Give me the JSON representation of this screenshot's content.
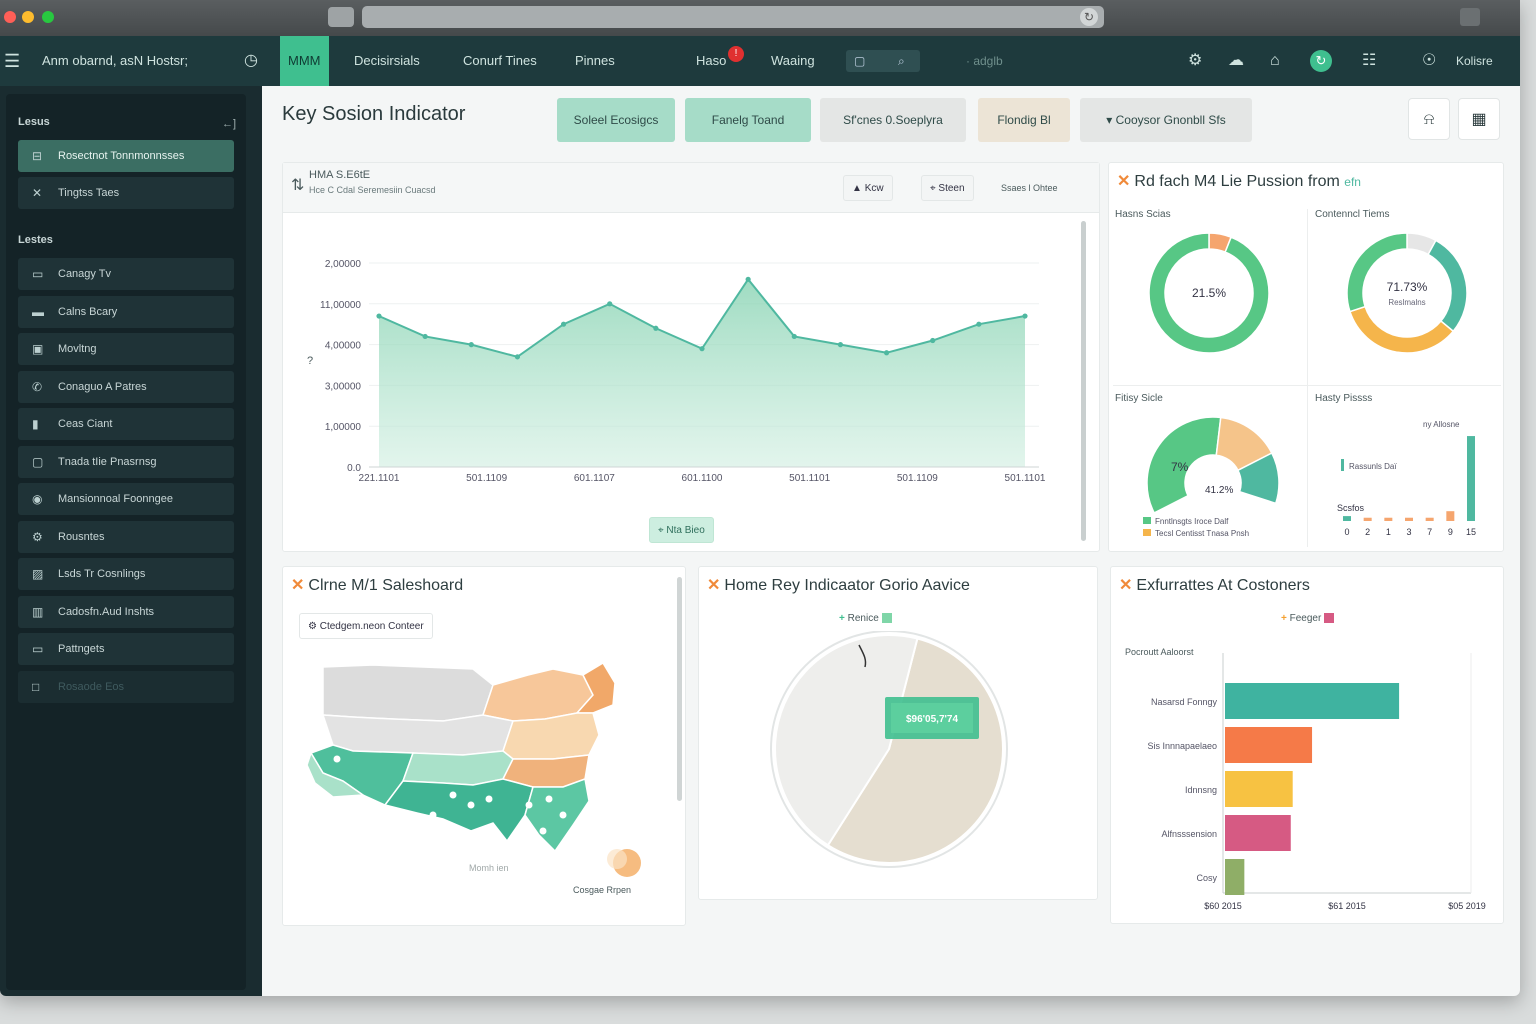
{
  "app": {
    "title": "Anm obarnd, asN Hostsr;",
    "window_icon": "camera-icon"
  },
  "nav": {
    "tabs": [
      {
        "label": "MMM",
        "active": true
      },
      {
        "label": "Decisirsials",
        "active": false
      },
      {
        "label": "Conurf Tines",
        "active": false
      },
      {
        "label": "Pinnes",
        "active": false
      },
      {
        "label": "Haso",
        "active": false
      },
      {
        "label": "Waaing",
        "active": false
      }
    ],
    "alert_count": "!",
    "search_icon_a": "▢",
    "search_icon_b": "⌕",
    "search_hint": "· adglb",
    "user_label": "Kolisre"
  },
  "sidebar": {
    "section1": "Lesus",
    "collapse": "←]",
    "items_top": [
      {
        "label": "Rosectnot Tonnmonnsses",
        "icon": "⊟",
        "active": true
      },
      {
        "label": "Tingtss Taes",
        "icon": "✕",
        "active": false
      }
    ],
    "section2": "Lestes",
    "items": [
      {
        "label": "Canagy Tv",
        "icon": "▭"
      },
      {
        "label": "Calns Bcary",
        "icon": "▬"
      },
      {
        "label": "Movltng",
        "icon": "▣"
      },
      {
        "label": "Conaguo A Patres",
        "icon": "✆"
      },
      {
        "label": "Ceas Ciant",
        "icon": "▮"
      },
      {
        "label": "Tnada tIie Pnasrnsg",
        "icon": "▢"
      },
      {
        "label": "Mansionnoal Foonngee",
        "icon": "◉"
      },
      {
        "label": "Rousntes",
        "icon": "⚙"
      },
      {
        "label": "Lsds Tr Cosnlings",
        "icon": "▨"
      },
      {
        "label": "Cadosfn.Aud Inshts",
        "icon": "▥"
      },
      {
        "label": "Pattngets",
        "icon": "▭"
      },
      {
        "label": "Rosaode Eos",
        "icon": "□"
      }
    ]
  },
  "header": {
    "title": "Key Sosion Indicator",
    "filters": [
      {
        "label": "Soleel Ecosigcs",
        "bg": "#a6dcc8"
      },
      {
        "label": "Fanelg Toand",
        "bg": "#a6dcc8"
      },
      {
        "label": "Sf'cnes 0.Soeplyra",
        "bg": "#e4e6e5"
      },
      {
        "label": "Flondig Bl",
        "bg": "#ece4d6"
      },
      {
        "label": "▾ Cooysor Gnonbll Sfs",
        "bg": "#e4e6e5"
      }
    ],
    "bell_icon": "⍾",
    "grid_icon": "▦"
  },
  "trend": {
    "title": "HMA S.E6tE",
    "subtitle": "Hce C Cdal Seremesiin Cuacsd",
    "sort_icon": "⇅",
    "btn_a_icon": "▲",
    "btn_a": "Kcw",
    "btn_b_icon": "⌖",
    "btn_b": "Steen",
    "btn_c": "Ssaes l Ohtee",
    "y_marker": "?",
    "footer_chip": "⌖ Nta Bieo"
  },
  "donuts_panel": {
    "title": "Rd fach M4 Lie Pussion from",
    "title_badge": "efn",
    "q1_label": "Hasns Scias",
    "q1_value": "21.5%",
    "q2_label": "Contenncl Tiems",
    "q2_value": "71.73%",
    "q2_sub": "Reslmalns",
    "q3_label": "Fitisy Sicle",
    "q3_value_a": "7%",
    "q3_value_b": "41.2%",
    "q3_legend_a": "Fnntlnsgts Iroce Dalf",
    "q3_legend_b": "Tecsl Centisst Tnasa Pnsh",
    "q4_label": "Hasty Pissss",
    "q4_note": "ny Allosne",
    "q4_legend": "Rassunls Daï",
    "q4_axis_title": "Scsfos",
    "q4_ticks": [
      "0",
      "2",
      "1",
      "3",
      "7",
      "9",
      "15"
    ]
  },
  "map_panel": {
    "title": "Clrne M/1 Saleshoard",
    "chip": "⚙ Ctedgem.neon Conteer",
    "foot_label": "Momh ien",
    "legend_label": "Cosgae Rrpen"
  },
  "pie_panel": {
    "title": "Home Rey Indicaator Gorio Aavice",
    "legend_label": "Renice",
    "callout": "$96'05,7'74"
  },
  "bar_panel": {
    "title": "Exfurrattes At Costoners",
    "legend_label": "Feeger",
    "y_header": "Pocroutt Aaloorst"
  },
  "colors": {
    "accent": "#3fbf8f",
    "teal": "#4fb8a0",
    "nav_bg": "#1e3a3d",
    "sidebar_bg": "#142327",
    "orange": "#f08a3a"
  },
  "chart_data": [
    {
      "type": "area",
      "title": "HMA S.E6tE",
      "x_tick_labels": [
        "221.1101",
        "501.1109",
        "601.1107",
        "601.1100",
        "501.1101",
        "501.1109",
        "501.1101"
      ],
      "y_tick_labels": [
        "0.0",
        "1,00000",
        "3,00000",
        "4,00000",
        "11,00000",
        "2,00000"
      ],
      "ylim": [
        0,
        5
      ],
      "x": [
        0,
        0.5,
        1,
        1.5,
        2,
        2.5,
        3,
        3.5,
        4,
        4.5,
        5,
        5.5,
        6,
        6.5,
        7
      ],
      "values": [
        3.7,
        3.2,
        3.0,
        2.7,
        3.5,
        4.0,
        3.4,
        2.9,
        4.6,
        3.2,
        3.0,
        2.8,
        3.1,
        3.5,
        3.7
      ],
      "series": [
        {
          "name": "",
          "color": "#4fb8a0"
        }
      ]
    },
    {
      "type": "pie",
      "title": "Hasns Scias",
      "values": [
        0.06,
        0.94
      ],
      "colors": [
        "#f5a56e",
        "#57c785"
      ],
      "center_label": "21.5%"
    },
    {
      "type": "pie",
      "title": "Contenncl Tiems",
      "values": [
        0.08,
        0.28,
        0.34,
        0.3
      ],
      "colors": [
        "#e6e6e6",
        "#4fb8a0",
        "#f5b54b",
        "#57c785"
      ],
      "center_label": "71.73%"
    },
    {
      "type": "pie",
      "title": "Fitisy Sicle",
      "values": [
        0.55,
        0.25,
        0.2
      ],
      "colors": [
        "#57c785",
        "#f5c48a",
        "#4fb8a0"
      ],
      "labels": [
        "7%",
        "41.2%"
      ]
    },
    {
      "type": "bar",
      "title": "Hasty Pissss",
      "categories": [
        "0",
        "2",
        "1",
        "3",
        "7",
        "9",
        "15"
      ],
      "values": [
        0.3,
        0.2,
        0.2,
        0.2,
        0.2,
        0.6,
        5.2
      ],
      "colors": [
        "#4fb8a0",
        "#f5a56e",
        "#f5a56e",
        "#f5a56e",
        "#f5a56e",
        "#f5a56e",
        "#4fb8a0"
      ],
      "ylim": [
        0,
        6
      ]
    },
    {
      "type": "pie",
      "title": "Home Rey Indicaator Gorio Aavice",
      "values": [
        0.55,
        0.45
      ],
      "colors": [
        "#e5ded0",
        "#eeeeec"
      ],
      "annotation": "$96'05,7'74"
    },
    {
      "type": "bar",
      "title": "Exfurrattes At Costoners",
      "orientation": "horizontal",
      "categories": [
        "Nasarsd Fonngy",
        "Sis Innnapaelaeo",
        "Idnnsng",
        "Alfnsssension",
        "Cosy"
      ],
      "values": [
        0.9,
        0.45,
        0.35,
        0.34,
        0.1
      ],
      "colors": [
        "#3fb3a0",
        "#f57a48",
        "#f7c242",
        "#d65a83",
        "#8fae67"
      ],
      "x_tick_labels": [
        "$60 2015",
        "$61 2015",
        "$05 2019"
      ],
      "xlim": [
        0,
        1
      ]
    }
  ]
}
